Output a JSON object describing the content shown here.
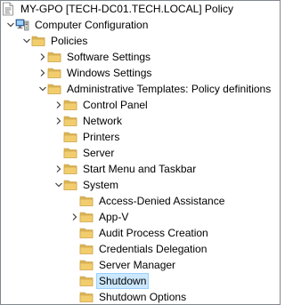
{
  "colors": {
    "folder_back": "#dcb45a",
    "folder_front": "#f2cd6e",
    "folder_edge": "#c49a3c",
    "arrow": "#404040",
    "selection_fill": "#cce8ff",
    "selection_border": "#99d1ff"
  },
  "tree": [
    {
      "id": "my-gpo-policy",
      "label": "MY-GPO [TECH-DC01.TECH.LOCAL] Policy",
      "depth": 0,
      "toggle": "none",
      "icon": "policy-document-icon",
      "selected": false
    },
    {
      "id": "computer-configuration",
      "label": "Computer Configuration",
      "depth": 0,
      "toggle": "expanded",
      "icon": "computer-icon",
      "selected": false
    },
    {
      "id": "policies",
      "label": "Policies",
      "depth": 1,
      "toggle": "expanded",
      "icon": "folder-icon",
      "selected": false
    },
    {
      "id": "software-settings",
      "label": "Software Settings",
      "depth": 2,
      "toggle": "collapsed",
      "icon": "folder-icon",
      "selected": false
    },
    {
      "id": "windows-settings",
      "label": "Windows Settings",
      "depth": 2,
      "toggle": "collapsed",
      "icon": "folder-icon",
      "selected": false
    },
    {
      "id": "administrative-templates",
      "label": "Administrative Templates: Policy definitions",
      "depth": 2,
      "toggle": "expanded",
      "icon": "folder-icon",
      "selected": false
    },
    {
      "id": "control-panel",
      "label": "Control Panel",
      "depth": 3,
      "toggle": "collapsed",
      "icon": "folder-icon",
      "selected": false
    },
    {
      "id": "network",
      "label": "Network",
      "depth": 3,
      "toggle": "collapsed",
      "icon": "folder-icon",
      "selected": false
    },
    {
      "id": "printers",
      "label": "Printers",
      "depth": 3,
      "toggle": "none",
      "icon": "folder-icon",
      "selected": false
    },
    {
      "id": "server",
      "label": "Server",
      "depth": 3,
      "toggle": "none",
      "icon": "folder-icon",
      "selected": false
    },
    {
      "id": "start-menu-and-taskbar",
      "label": "Start Menu and Taskbar",
      "depth": 3,
      "toggle": "collapsed",
      "icon": "folder-icon",
      "selected": false
    },
    {
      "id": "system",
      "label": "System",
      "depth": 3,
      "toggle": "expanded",
      "icon": "folder-icon",
      "selected": false
    },
    {
      "id": "access-denied-assistance",
      "label": "Access-Denied Assistance",
      "depth": 4,
      "toggle": "none",
      "icon": "folder-icon",
      "selected": false
    },
    {
      "id": "app-v",
      "label": "App-V",
      "depth": 4,
      "toggle": "collapsed",
      "icon": "folder-icon",
      "selected": false
    },
    {
      "id": "audit-process-creation",
      "label": "Audit Process Creation",
      "depth": 4,
      "toggle": "none",
      "icon": "folder-icon",
      "selected": false
    },
    {
      "id": "credentials-delegation",
      "label": "Credentials Delegation",
      "depth": 4,
      "toggle": "none",
      "icon": "folder-icon",
      "selected": false
    },
    {
      "id": "server-manager",
      "label": "Server Manager",
      "depth": 4,
      "toggle": "none",
      "icon": "folder-icon",
      "selected": false
    },
    {
      "id": "shutdown",
      "label": "Shutdown",
      "depth": 4,
      "toggle": "none",
      "icon": "folder-icon",
      "selected": true
    },
    {
      "id": "shutdown-options",
      "label": "Shutdown Options",
      "depth": 4,
      "toggle": "none",
      "icon": "folder-icon",
      "selected": false
    }
  ]
}
